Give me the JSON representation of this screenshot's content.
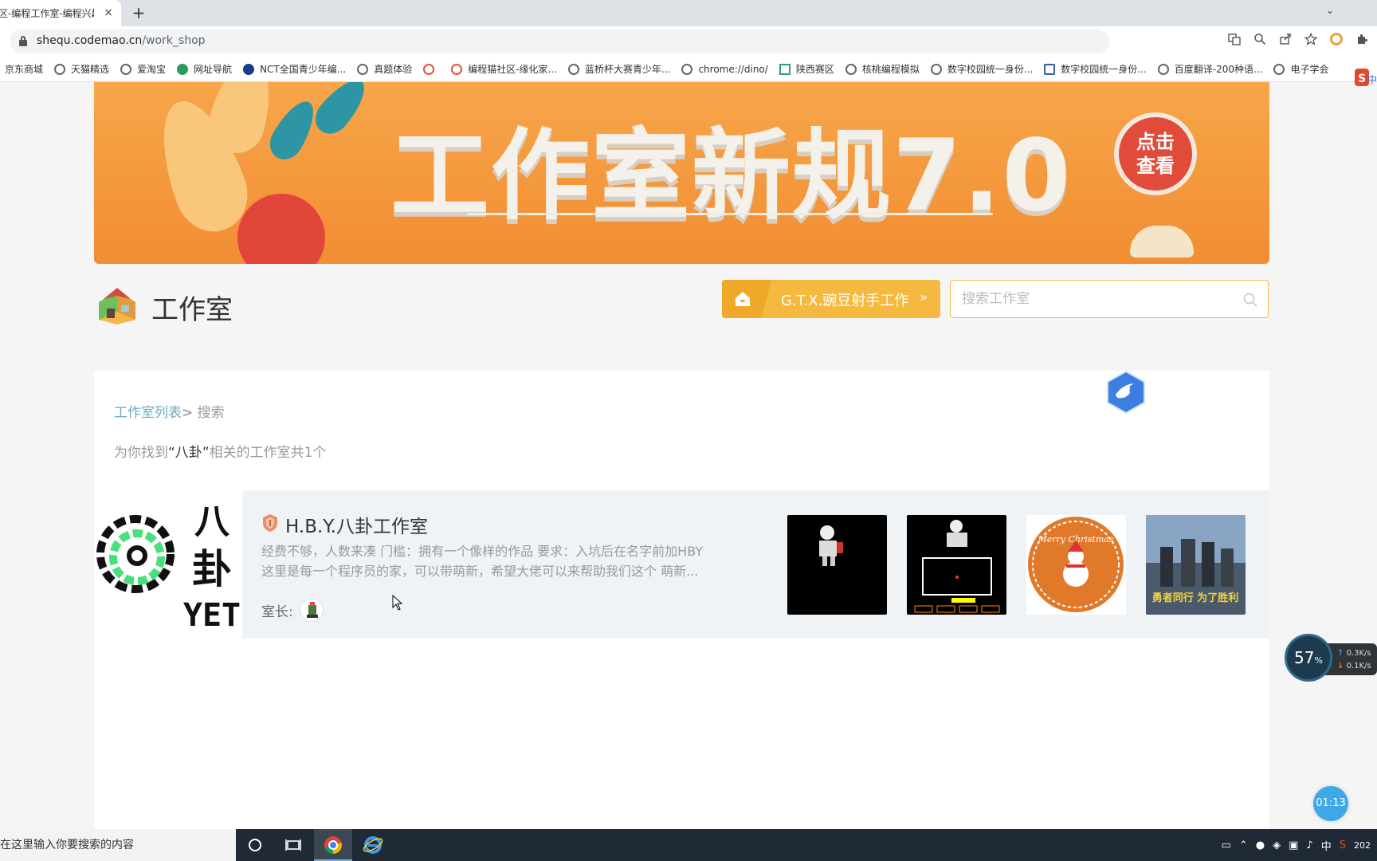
{
  "browser": {
    "tab_title": "区-编程工作室-编程兴趣",
    "tab_close": "×",
    "new_tab": "+",
    "tab_list": "⌄",
    "url_host": "shequ.codemao.cn",
    "url_path": "/work_shop",
    "bookmarks": [
      "京东商城",
      "天猫精选",
      "爱淘宝",
      "网址导航",
      "NCT全国青少年编...",
      "真题体验",
      "",
      "编程猫社区-缘化家...",
      "蓝桥杯大赛青少年...",
      "chrome://dino/",
      "陕西赛区",
      "核桃编程模拟",
      "数字校园统一身份...",
      "数字校园统一身份...",
      "百度翻译-200种语...",
      "电子学会"
    ]
  },
  "banner": {
    "headline": "工作室新规7.0",
    "button_line1": "点击",
    "button_line2": "查看"
  },
  "header": {
    "title": "工作室",
    "my_workshop": "G.T.X.豌豆射手工作室",
    "my_workshop_arrow": "»",
    "search_placeholder": "搜索工作室"
  },
  "results": {
    "breadcrumb_link": "工作室列表",
    "breadcrumb_sep": ">",
    "breadcrumb_current": " 搜索",
    "count_prefix": "为你找到",
    "keyword": "“八卦”",
    "count_suffix": "相关的工作室共1个"
  },
  "card": {
    "cover_text_top": "八",
    "cover_text_mid": "卦",
    "cover_text_bottom": "YET",
    "name": "H.B.Y.八卦工作室",
    "desc_line1": "经费不够，人数来凑 门槛：拥有一个像样的作品 要求：入坑后在名字前加HBY",
    "desc_line2": "这里是每一个程序员的家，可以带萌新，希望大佬可以来帮助我们这个 萌新...",
    "owner_label": "室长:",
    "thumb3_text": "Merry Christmas",
    "thumb4_text": "勇者同行 为了胜利"
  },
  "overlay": {
    "stat_percent": "57",
    "stat_unit": "%",
    "upload": "0.3K/s",
    "download": "0.1K/s",
    "timer": "01:13",
    "ime_label": "中"
  },
  "taskbar": {
    "search_text": "在这里输入你要搜索的内容",
    "ime": "中",
    "clock": "202"
  },
  "colors": {
    "accent_orange": "#f5b93f",
    "banner_orange": "#f28d33",
    "link_blue": "#6fa8c8"
  }
}
